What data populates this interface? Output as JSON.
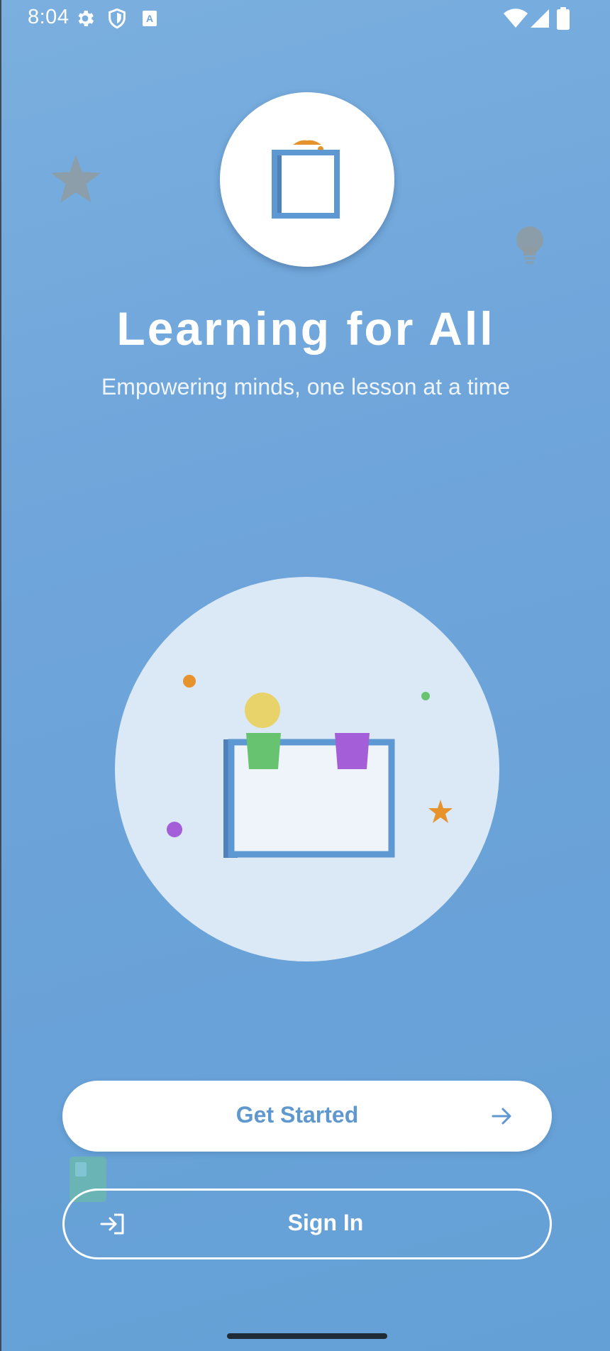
{
  "status_bar": {
    "time": "8:04",
    "icons": [
      "gear-icon",
      "shield-icon",
      "a-badge-icon",
      "wifi-icon",
      "signal-icon",
      "battery-icon"
    ]
  },
  "app": {
    "title": "Learning for All",
    "subtitle": "Empowering minds, one lesson at a time",
    "logo_icon": "book-icon",
    "illustration_icon": "classroom-illustration-icon"
  },
  "actions": {
    "get_started_label": "Get Started",
    "get_started_icon": "arrow-right-icon",
    "sign_in_label": "Sign In",
    "sign_in_icon": "login-icon"
  },
  "colors": {
    "background_top": "#7aafdf",
    "background_bottom": "#64a0d6",
    "primary_text": "#5f98cf",
    "accent_orange": "#e6932e",
    "accent_green": "#67c36f",
    "accent_purple": "#a35ed8",
    "accent_yellow": "#e8d36a"
  }
}
